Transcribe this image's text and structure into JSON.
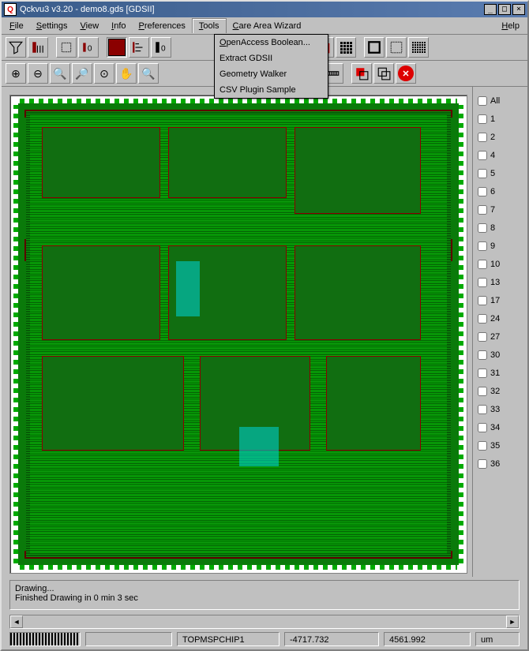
{
  "title": "Qckvu3 v3.20 - demo8.gds [GDSII]",
  "menu": {
    "file": "File",
    "settings": "Settings",
    "view": "View",
    "info": "Info",
    "preferences": "Preferences",
    "tools": "Tools",
    "care": "Care Area Wizard",
    "help": "Help"
  },
  "tools_dropdown": [
    "OpenAccess Boolean...",
    "Extract GDSII",
    "Geometry Walker",
    "CSV Plugin Sample"
  ],
  "layers": {
    "all": "All",
    "items": [
      "1",
      "2",
      "4",
      "5",
      "6",
      "7",
      "8",
      "9",
      "10",
      "13",
      "17",
      "24",
      "27",
      "30",
      "31",
      "32",
      "33",
      "34",
      "35",
      "36"
    ]
  },
  "status": {
    "line1": "Drawing...",
    "line2": "Finished Drawing in 0 min 3 sec"
  },
  "footer": {
    "cell": "TOPMSPCHIP1",
    "x": "-4717.732",
    "y": "4561.992",
    "unit": "um"
  }
}
